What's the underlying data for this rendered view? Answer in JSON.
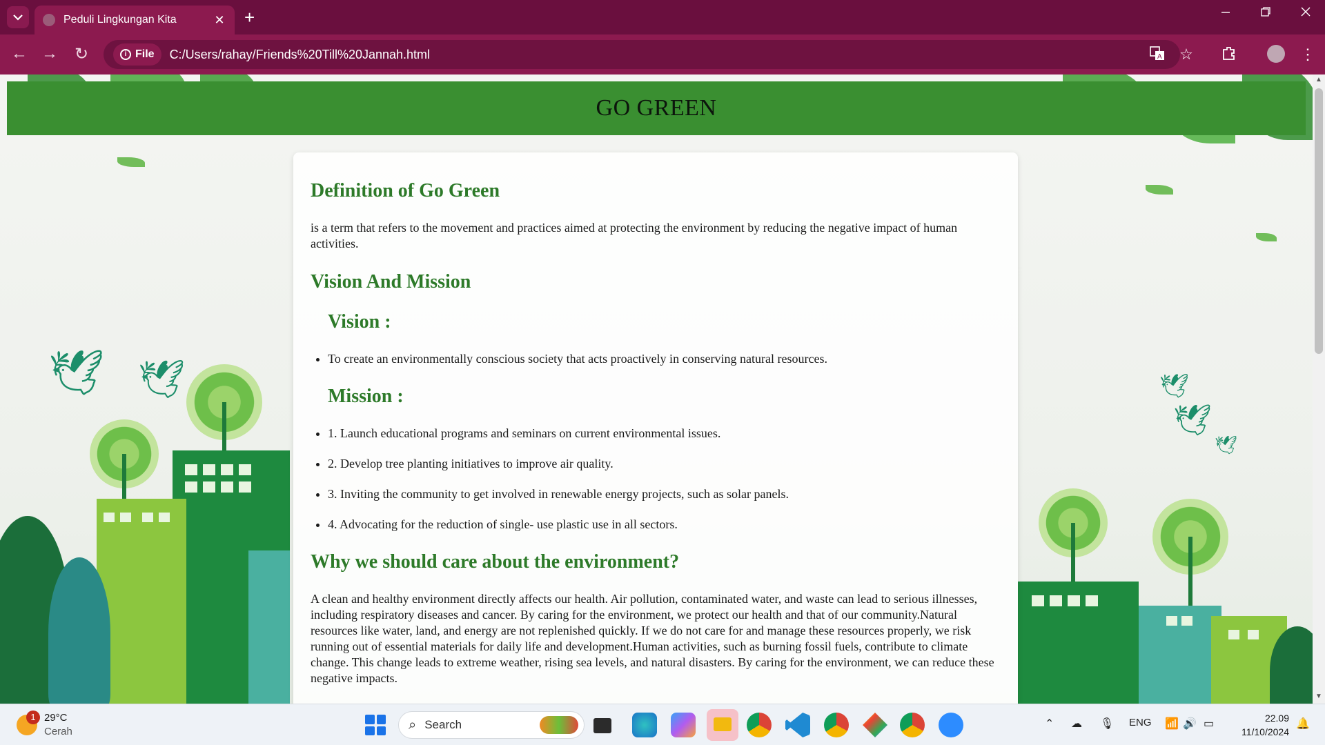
{
  "browser": {
    "tab_title": "Peduli Lingkungan Kita",
    "tab_close": "✕",
    "new_tab": "+",
    "site_chip": "File",
    "url": "C:/Users/rahay/Friends%20Till%20Jannah.html",
    "accent_color": "#8c1a4f"
  },
  "page": {
    "banner_title": "GO GREEN",
    "definition": {
      "heading": "Definition of Go Green",
      "text": "is a term that refers to the movement and practices aimed at protecting the environment by reducing the negative impact of human activities."
    },
    "vision_mission": {
      "heading": "Vision And Mission",
      "vision_heading": "Vision :",
      "vision_items": [
        "To create an environmentally conscious society that acts proactively in conserving natural resources."
      ],
      "mission_heading": "Mission :",
      "mission_items": [
        "1. Launch educational programs and seminars on current environmental issues.",
        "2. Develop tree planting initiatives to improve air quality.",
        "3. Inviting the community to get involved in renewable energy projects, such as solar panels.",
        "4. Advocating for the reduction of single- use plastic use in all sectors."
      ]
    },
    "why_care": {
      "heading": "Why we should care about the environment?",
      "text": "A clean and healthy environment directly affects our health. Air pollution, contaminated water, and waste can lead to serious illnesses, including respiratory diseases and cancer. By caring for the environment, we protect our health and that of our community.Natural resources like water, land, and energy are not replenished quickly. If we do not care for and manage these resources properly, we risk running out of essential materials for daily life and development.Human activities, such as burning fossil fuels, contribute to climate change. This change leads to extreme weather, rising sea levels, and natural disasters. By caring for the environment, we can reduce these negative impacts."
    },
    "green_color": "#2d7a29",
    "banner_color": "#3a8f31"
  },
  "taskbar": {
    "weather_badge": "1",
    "temperature": "29°C",
    "condition": "Cerah",
    "search_placeholder": "Search",
    "language": "ENG",
    "time": "22.09",
    "date": "11/10/2024"
  }
}
